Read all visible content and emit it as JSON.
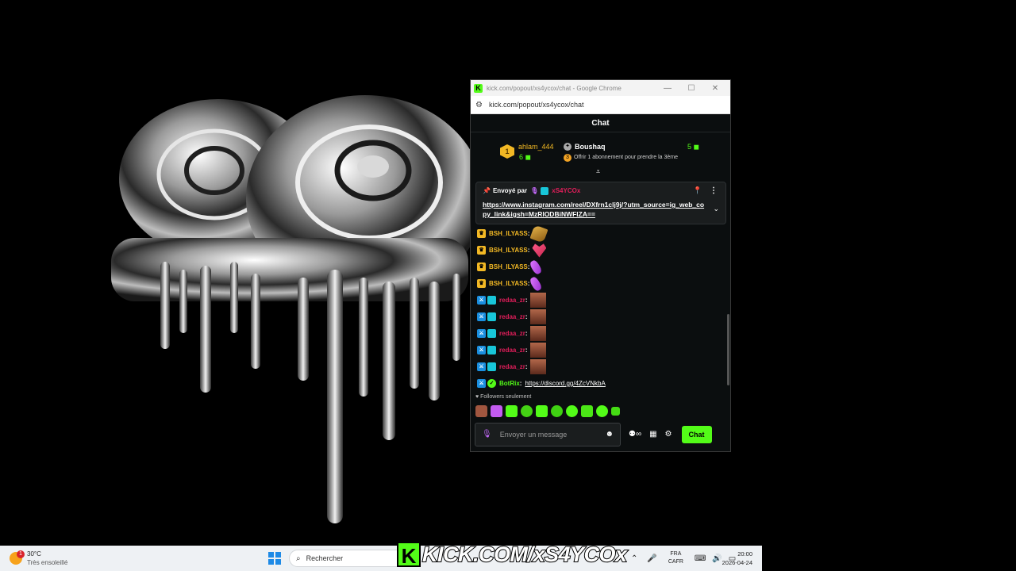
{
  "window": {
    "title": "kick.com/popout/xs4ycox/chat - Google Chrome",
    "favicon": "K",
    "url": "kick.com/popout/xs4ycox/chat"
  },
  "chat": {
    "header": "Chat",
    "leaderboard": {
      "rank": "1",
      "top_user": "ahlam_444",
      "top_count": "6",
      "second_user": "Boushaq",
      "second_count": "5",
      "offer_text": "Offrir 1 abonnement pour prendre la 3ème"
    },
    "pinned": {
      "label": "Envoyé par",
      "sender": "xS4YCOx",
      "link": "https://www.instagram.com/reel/DXfrn1clj9j/?utm_source=ig_web_copy_link&igsh=MzRlODBiNWFlZA=="
    },
    "messages": [
      {
        "badge": "crown",
        "user": "BSH_ILYASS",
        "emote": "clap",
        "color": "gold"
      },
      {
        "badge": "crown",
        "user": "BSH_ILYASS",
        "emote": "heart",
        "color": "gold"
      },
      {
        "badge": "crown",
        "user": "BSH_ILYASS",
        "emote": "mic",
        "color": "gold"
      },
      {
        "badge": "crown",
        "user": "BSH_ILYASS",
        "emote": "mic",
        "color": "gold"
      },
      {
        "badge": "mod",
        "user": "redaa_zr",
        "emote": "face",
        "color": "red"
      },
      {
        "badge": "mod",
        "user": "redaa_zr",
        "emote": "face",
        "color": "red"
      },
      {
        "badge": "mod",
        "user": "redaa_zr",
        "emote": "face",
        "color": "red"
      },
      {
        "badge": "mod",
        "user": "redaa_zr",
        "emote": "face",
        "color": "red"
      },
      {
        "badge": "mod",
        "user": "redaa_zr",
        "emote": "face",
        "color": "red"
      }
    ],
    "bot_message": {
      "user": "BotRix",
      "link": "https://discord.gg/4ZcVNkbA"
    },
    "followers_only": "Followers seulement",
    "input_placeholder": "Envoyer un message",
    "chat_button": "Chat"
  },
  "taskbar": {
    "weather_temp": "30°C",
    "weather_desc": "Très ensoleillé",
    "weather_alert": "1",
    "search_placeholder": "Rechercher",
    "banner_text": "KICK.COM/xS4YCOx",
    "lang_top": "FRA",
    "lang_bottom": "CAFR",
    "time": "20:00",
    "date": "2026-04-24"
  },
  "colors": {
    "kick_green": "#53fc18",
    "gold": "#f2b824",
    "red_user": "#e01e5a",
    "chat_bg": "#0b0e0f"
  }
}
